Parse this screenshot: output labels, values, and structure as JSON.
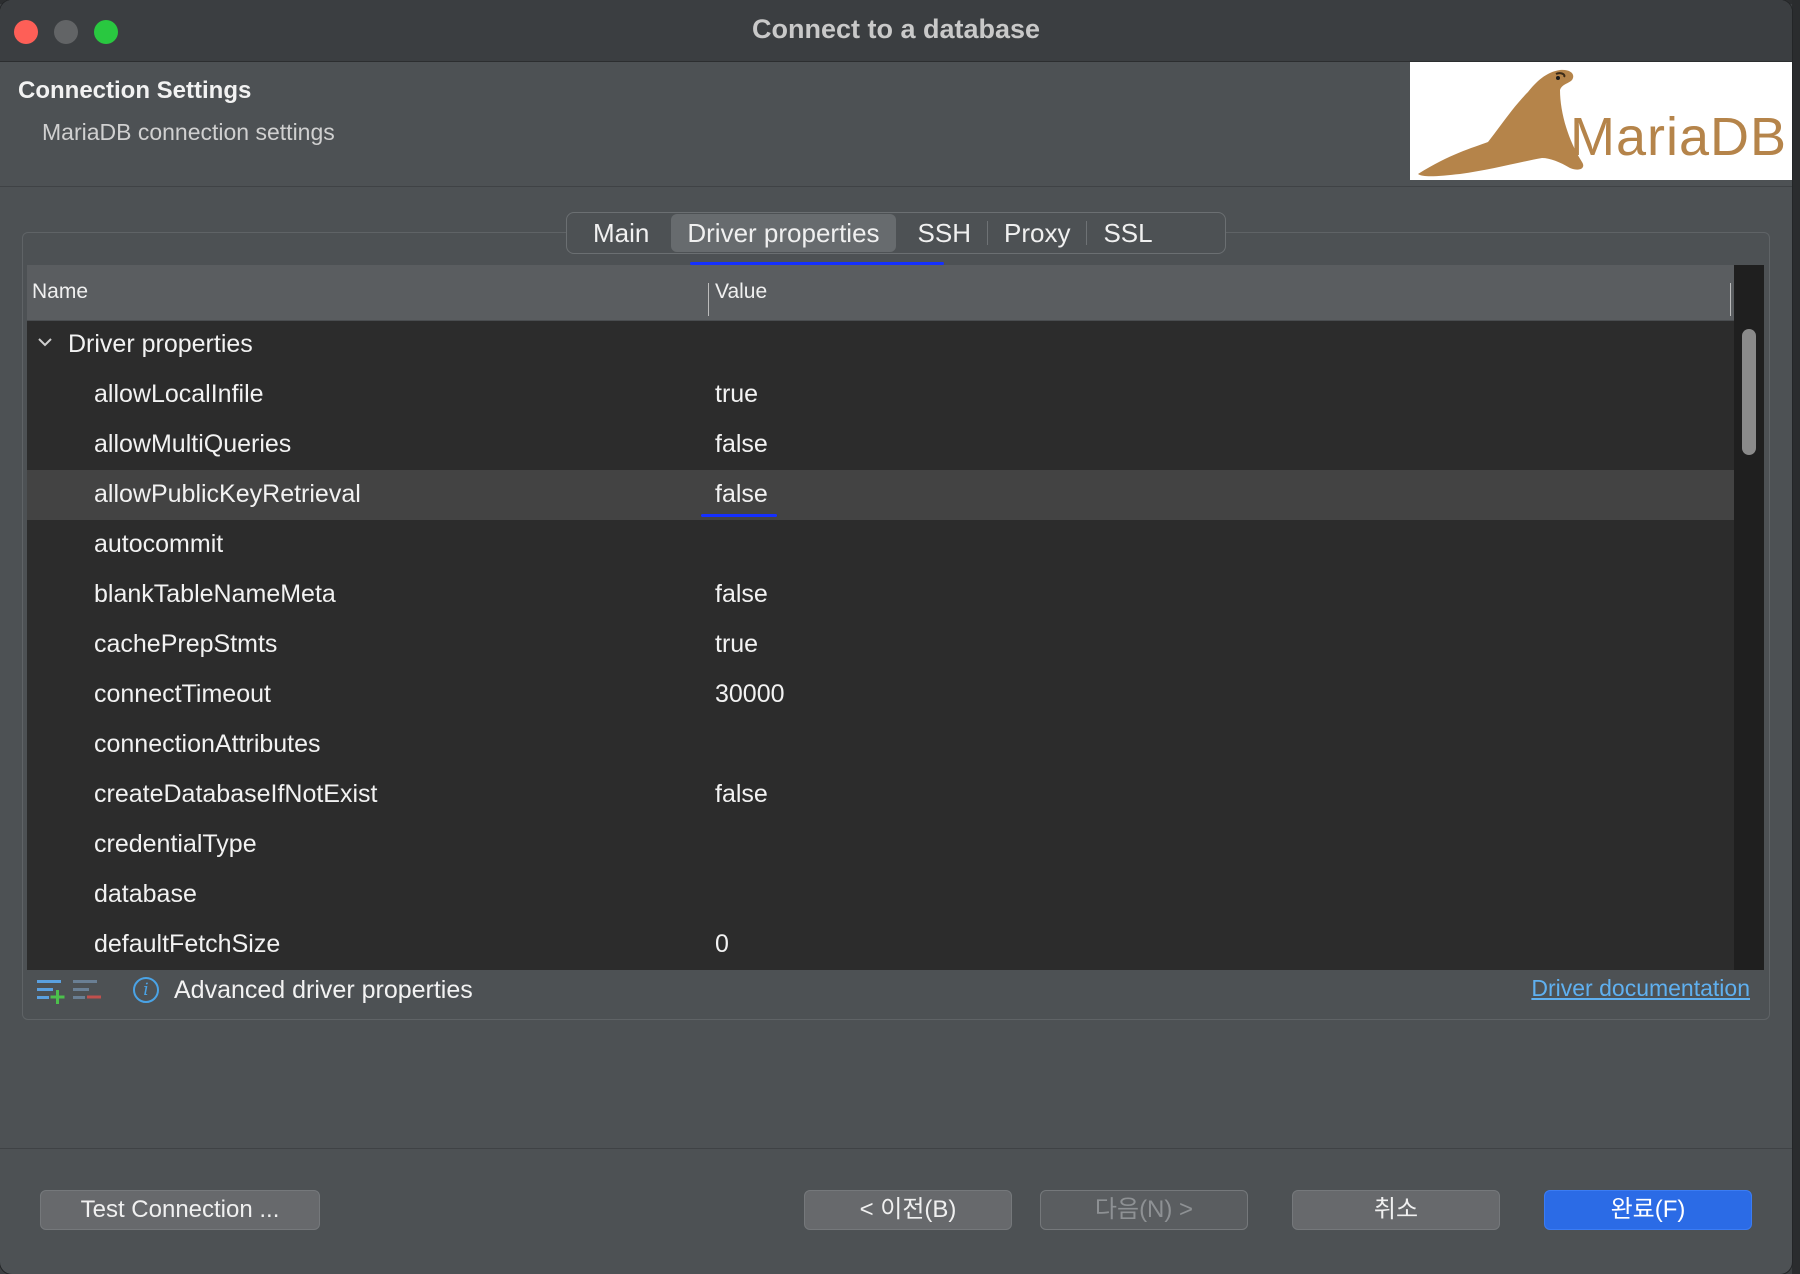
{
  "window": {
    "title": "Connect to a database"
  },
  "header": {
    "title": "Connection Settings",
    "subtitle": "MariaDB connection settings",
    "logo_text": "MariaDB"
  },
  "tabs": [
    {
      "label": "Main",
      "active": false
    },
    {
      "label": "Driver properties",
      "active": true
    },
    {
      "label": "SSH",
      "active": false
    },
    {
      "label": "Proxy",
      "active": false
    },
    {
      "label": "SSL",
      "active": false
    }
  ],
  "table": {
    "columns": {
      "name": "Name",
      "value": "Value"
    },
    "category": "Driver properties",
    "rows": [
      {
        "name": "allowLocalInfile",
        "value": "true"
      },
      {
        "name": "allowMultiQueries",
        "value": "false"
      },
      {
        "name": "allowPublicKeyRetrieval",
        "value": "false",
        "selected": true
      },
      {
        "name": "autocommit",
        "value": ""
      },
      {
        "name": "blankTableNameMeta",
        "value": "false"
      },
      {
        "name": "cachePrepStmts",
        "value": "true"
      },
      {
        "name": "connectTimeout",
        "value": "30000"
      },
      {
        "name": "connectionAttributes",
        "value": ""
      },
      {
        "name": "createDatabaseIfNotExist",
        "value": "false"
      },
      {
        "name": "credentialType",
        "value": ""
      },
      {
        "name": "database",
        "value": ""
      },
      {
        "name": "defaultFetchSize",
        "value": "0"
      }
    ]
  },
  "footer_bar": {
    "advanced_label": "Advanced driver properties",
    "doc_link": "Driver documentation",
    "add_icon": "add-property-icon",
    "remove_icon": "remove-property-icon",
    "info_icon": "info-icon"
  },
  "buttons": {
    "test_connection": "Test Connection ...",
    "back": "< 이전(B)",
    "next": "다음(N) >",
    "cancel": "취소",
    "finish": "완료(F)"
  },
  "colors": {
    "accent_blue": "#2b6be6",
    "annotation_blue": "#1530ff",
    "link": "#5fb0f0"
  }
}
